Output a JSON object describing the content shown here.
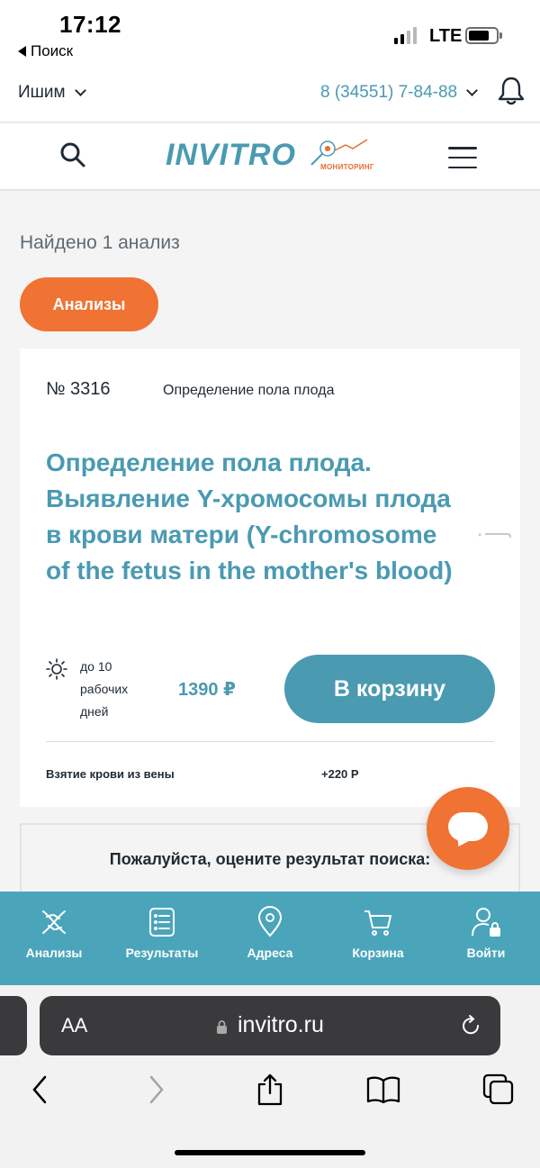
{
  "status_bar": {
    "time": "17:12",
    "back_label": "Поиск",
    "network": "LTE"
  },
  "city_bar": {
    "city": "Ишим",
    "phone": "8 (34551) 7-84-88"
  },
  "header": {
    "logo": "INVITRO",
    "logo_badge": "МОНИТОРИНГ"
  },
  "results": {
    "found_text": "Найдено 1 анализ",
    "category_pill": "Анализы"
  },
  "card": {
    "number": "№ 3316",
    "category": "Определение пола плода",
    "title": "Определение пола плода. Выявление Y-хромосомы плода в крови матери (Y-chromosome of the fetus in the mother's blood)",
    "term": "до 10 рабочих дней",
    "price": "1390 ₽",
    "cart_button": "В корзину",
    "extra_service": "Взятие крови из вены",
    "extra_price": "+220 Р"
  },
  "rating": {
    "question": "Пожалуйста, оцените результат поиска:"
  },
  "bottom_nav": {
    "items": [
      {
        "label": "Анализы",
        "icon": "dna-icon"
      },
      {
        "label": "Результаты",
        "icon": "list-document-icon"
      },
      {
        "label": "Адреса",
        "icon": "map-pin-icon"
      },
      {
        "label": "Корзина",
        "icon": "cart-icon"
      },
      {
        "label": "Войти",
        "icon": "user-lock-icon"
      }
    ]
  },
  "browser": {
    "aa": "AA",
    "url": "invitro.ru"
  },
  "colors": {
    "brand_teal": "#4a9ab2",
    "accent_orange": "#f07334",
    "nav_bg": "#4aa5bb"
  }
}
